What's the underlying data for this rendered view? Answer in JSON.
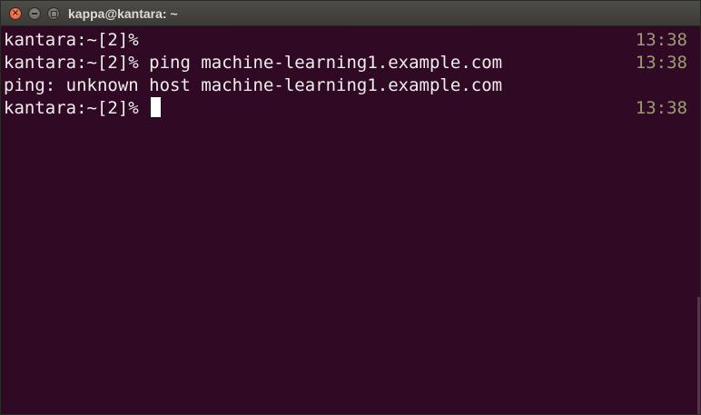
{
  "window": {
    "title": "kappa@kantara: ~",
    "buttons": {
      "close_icon": "close-icon",
      "minimize_icon": "minimize-icon",
      "maximize_icon": "maximize-icon",
      "close_glyph": "×"
    }
  },
  "terminal": {
    "background": "#300a24",
    "foreground": "#eeeeec",
    "timestamp_color": "#9b9b76",
    "lines": [
      {
        "text": "kantara:~[2]%",
        "time": "13:38"
      },
      {
        "text": "kantara:~[2]% ping machine-learning1.example.com",
        "time": "13:38"
      },
      {
        "text": "ping: unknown host machine-learning1.example.com",
        "time": ""
      },
      {
        "text": "kantara:~[2]% ",
        "time": "13:38"
      }
    ]
  }
}
